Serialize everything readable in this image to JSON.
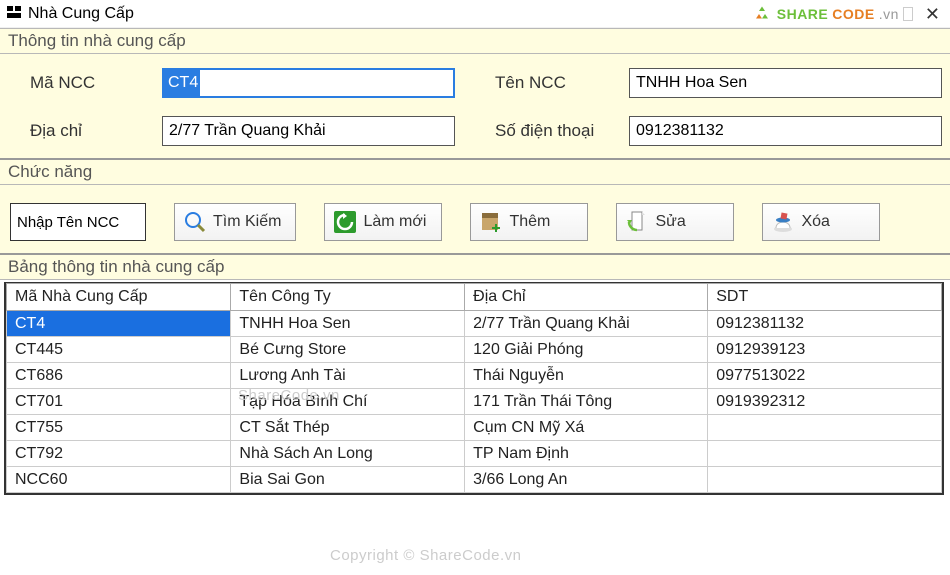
{
  "window": {
    "title": "Nhà Cung Cấp"
  },
  "brand": {
    "text1": "SHARE",
    "text2": "CODE",
    "text3": ".vn"
  },
  "sections": {
    "info": "Thông tin nhà cung cấp",
    "func": "Chức năng",
    "table": "Bảng thông tin nhà cung cấp"
  },
  "form": {
    "labels": {
      "mcc": "Mã NCC",
      "ten": "Tên NCC",
      "diachi": "Địa chỉ",
      "sdt": "Số điện thoại"
    },
    "values": {
      "mcc": "CT4",
      "ten": "TNHH Hoa Sen",
      "diachi": "2/77 Trần Quang Khải",
      "sdt": "0912381132"
    }
  },
  "func": {
    "search_placeholder": "Nhập Tên NCC",
    "buttons": {
      "tim": "Tìm Kiếm",
      "lammoi": "Làm mới",
      "them": "Thêm",
      "sua": "Sửa",
      "xoa": "Xóa"
    }
  },
  "table": {
    "headers": [
      "Mã Nhà Cung Cấp",
      "Tên Công Ty",
      "Địa Chỉ",
      "SDT"
    ],
    "rows": [
      [
        "CT4",
        "TNHH Hoa Sen",
        "2/77 Trần Quang Khải",
        "0912381132"
      ],
      [
        "CT445",
        "Bé Cưng Store",
        "120 Giải Phóng",
        "0912939123"
      ],
      [
        "CT686",
        "Lương Anh Tài",
        "Thái Nguyễn",
        "0977513022"
      ],
      [
        "CT701",
        "Tạp Hóa Bình Chí",
        "171 Trần Thái Tông",
        "0919392312"
      ],
      [
        "CT755",
        "CT Sắt Thép",
        "Cụm CN Mỹ Xá",
        ""
      ],
      [
        "CT792",
        "Nhà Sách An Long",
        "TP Nam Định",
        ""
      ],
      [
        "NCC60",
        "Bia Sai Gon",
        "3/66 Long An",
        ""
      ]
    ]
  },
  "watermarks": {
    "w1": "ShareCode.vn",
    "w2": "Copyright © ShareCode.vn"
  }
}
